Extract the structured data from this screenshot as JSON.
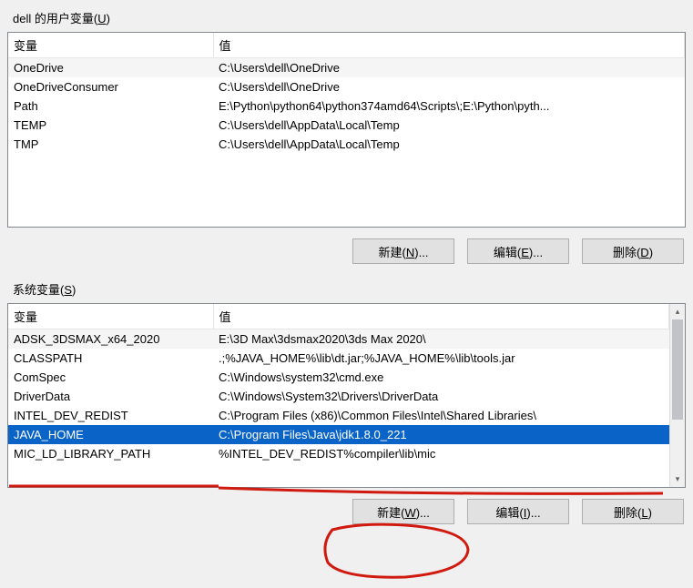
{
  "user_section": {
    "label_prefix": "dell 的用户变量(",
    "label_key": "U",
    "label_suffix": ")",
    "col_var": "变量",
    "col_val": "值",
    "rows": [
      {
        "var": "OneDrive",
        "val": "C:\\Users\\dell\\OneDrive"
      },
      {
        "var": "OneDriveConsumer",
        "val": "C:\\Users\\dell\\OneDrive"
      },
      {
        "var": "Path",
        "val": "E:\\Python\\python64\\python374amd64\\Scripts\\;E:\\Python\\pyth..."
      },
      {
        "var": "TEMP",
        "val": "C:\\Users\\dell\\AppData\\Local\\Temp"
      },
      {
        "var": "TMP",
        "val": "C:\\Users\\dell\\AppData\\Local\\Temp"
      }
    ],
    "buttons": {
      "new_pre": "新建(",
      "new_key": "N",
      "new_post": ")...",
      "edit_pre": "编辑(",
      "edit_key": "E",
      "edit_post": ")...",
      "del_pre": "删除(",
      "del_key": "D",
      "del_post": ")"
    }
  },
  "system_section": {
    "label_prefix": "系统变量(",
    "label_key": "S",
    "label_suffix": ")",
    "col_var": "变量",
    "col_val": "值",
    "rows": [
      {
        "var": "ADSK_3DSMAX_x64_2020",
        "val": "E:\\3D Max\\3dsmax2020\\3ds Max 2020\\"
      },
      {
        "var": "CLASSPATH",
        "val": ".;%JAVA_HOME%\\lib\\dt.jar;%JAVA_HOME%\\lib\\tools.jar"
      },
      {
        "var": "ComSpec",
        "val": "C:\\Windows\\system32\\cmd.exe"
      },
      {
        "var": "DriverData",
        "val": "C:\\Windows\\System32\\Drivers\\DriverData"
      },
      {
        "var": "INTEL_DEV_REDIST",
        "val": "C:\\Program Files (x86)\\Common Files\\Intel\\Shared Libraries\\"
      },
      {
        "var": "JAVA_HOME",
        "val": "C:\\Program Files\\Java\\jdk1.8.0_221",
        "selected": true
      },
      {
        "var": "MIC_LD_LIBRARY_PATH",
        "val": "%INTEL_DEV_REDIST%compiler\\lib\\mic"
      }
    ],
    "buttons": {
      "new_pre": "新建(",
      "new_key": "W",
      "new_post": ")...",
      "edit_pre": "编辑(",
      "edit_key": "I",
      "edit_post": ")...",
      "del_pre": "删除(",
      "del_key": "L",
      "del_post": ")"
    }
  }
}
